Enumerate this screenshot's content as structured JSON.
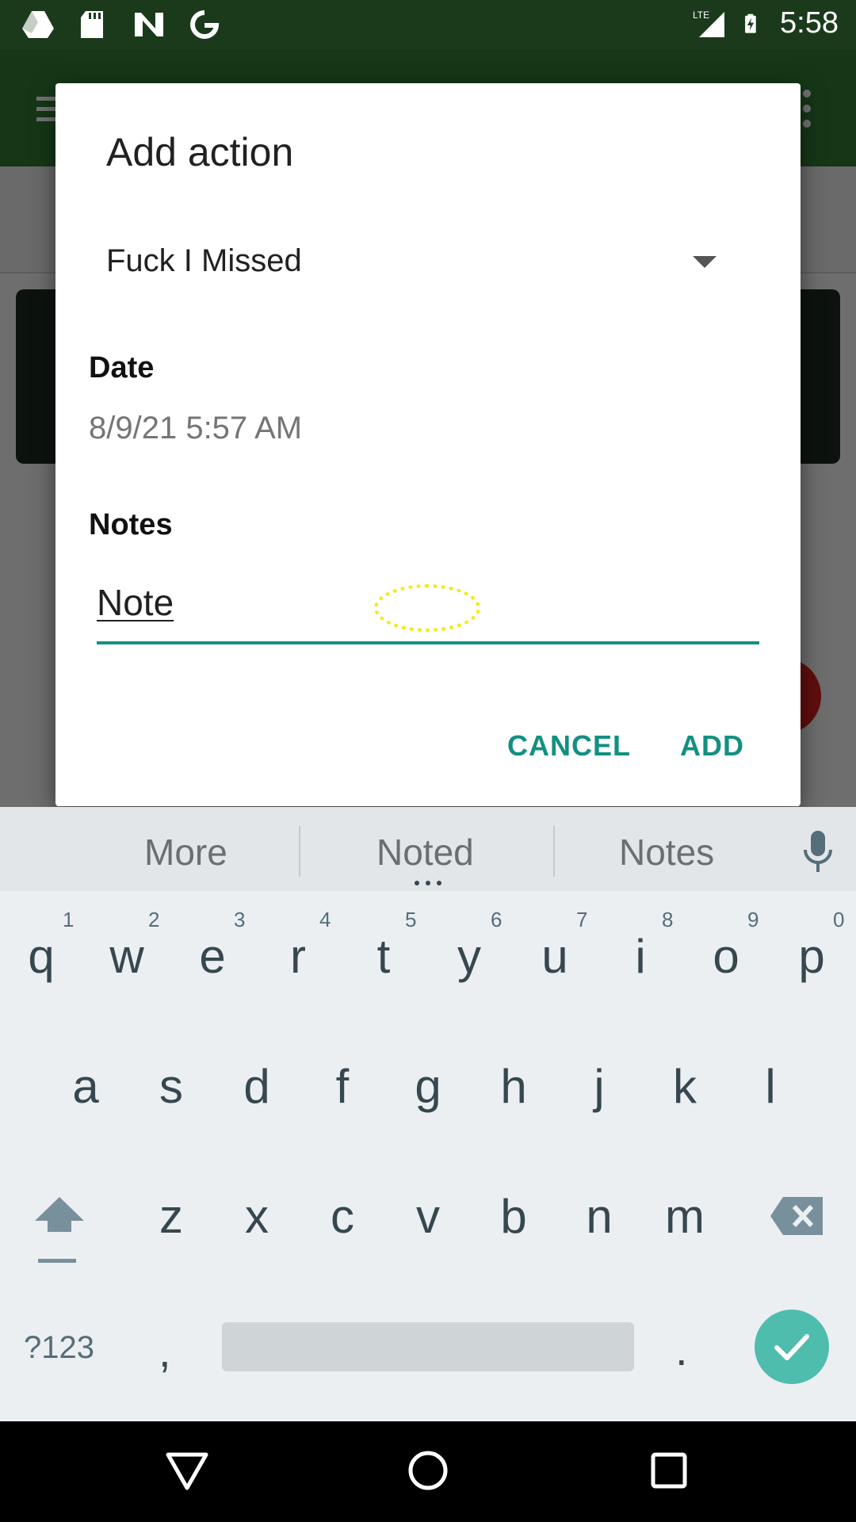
{
  "status_bar": {
    "time": "5:58",
    "left_icons": [
      "drive-icon",
      "sd-card-icon",
      "n-app-icon",
      "google-icon"
    ],
    "network": "LTE"
  },
  "dialog": {
    "title": "Add action",
    "action_spinner_value": "Fuck I Missed",
    "date_label": "Date",
    "date_value": "8/9/21 5:57 AM",
    "notes_label": "Notes",
    "notes_value": "Note",
    "cancel_label": "CANCEL",
    "add_label": "ADD"
  },
  "keyboard": {
    "suggestions": [
      "More",
      "Noted",
      "Notes"
    ],
    "row1": [
      "q",
      "w",
      "e",
      "r",
      "t",
      "y",
      "u",
      "i",
      "o",
      "p"
    ],
    "row1_hints": [
      "1",
      "2",
      "3",
      "4",
      "5",
      "6",
      "7",
      "8",
      "9",
      "0"
    ],
    "row2": [
      "a",
      "s",
      "d",
      "f",
      "g",
      "h",
      "j",
      "k",
      "l"
    ],
    "row3": [
      "z",
      "x",
      "c",
      "v",
      "b",
      "n",
      "m"
    ],
    "symbols_label": "?123",
    "comma_label": ",",
    "period_label": "."
  },
  "colors": {
    "accent": "#139186",
    "enter_key": "#4fbdae",
    "app_bar": "#2f7a34",
    "status_bar": "#1b3a1c"
  }
}
